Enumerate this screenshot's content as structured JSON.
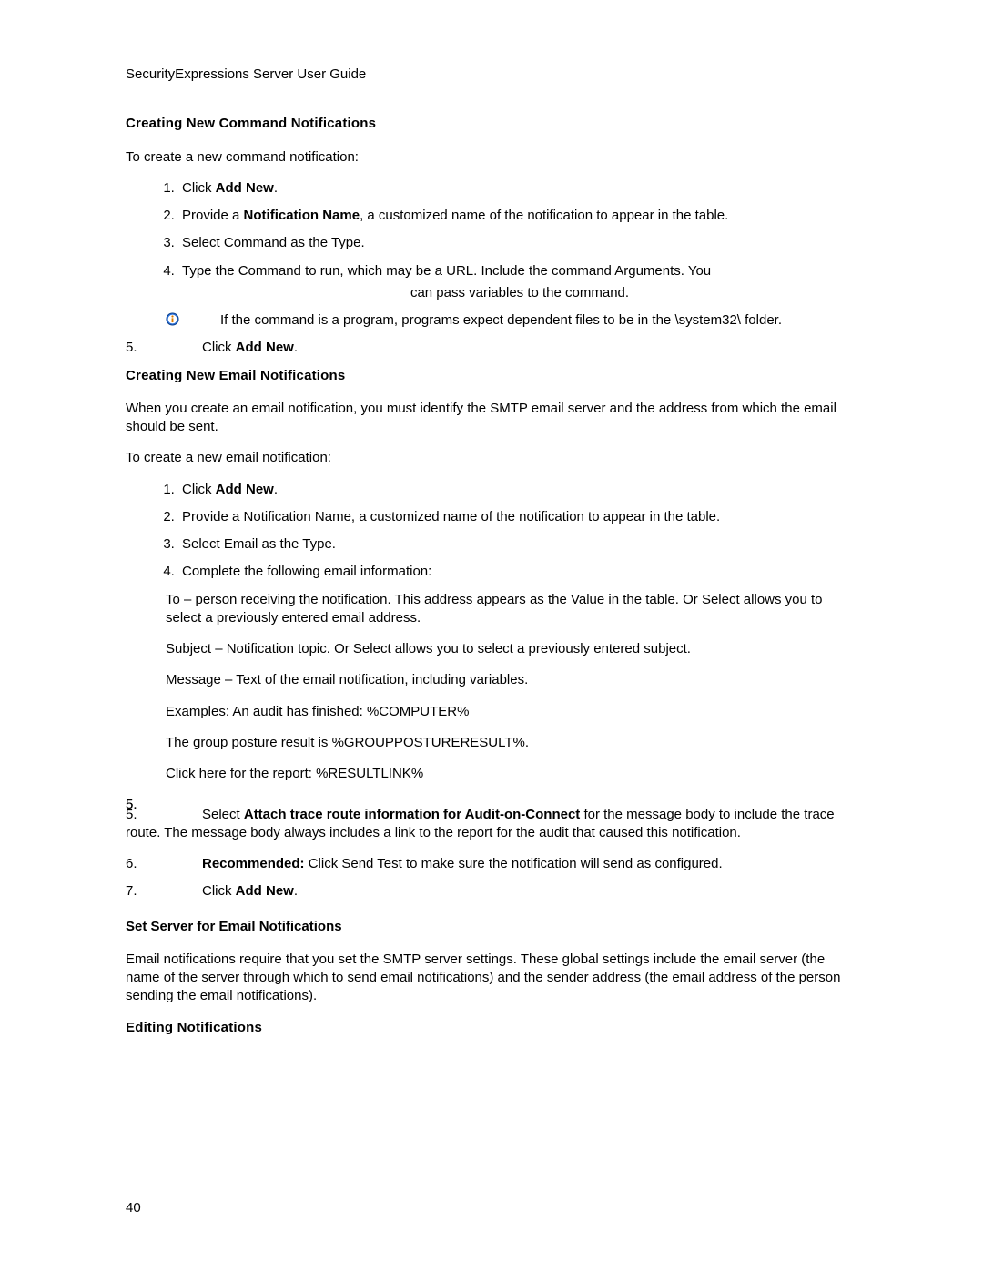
{
  "header": "SecurityExpressions Server User Guide",
  "h1": "Creating New Command Notifications",
  "p1": "To create a new command notification:",
  "list1": {
    "i1_pre": "Click ",
    "i1_bold": "Add New",
    "i1_post": ".",
    "i2_pre": "Provide a ",
    "i2_bold": "Notification Name",
    "i2_post": ", a customized name of the notification to appear in the table.",
    "i3": "Select Command as the Type.",
    "i4_line1": "Type the Command to run, which may be a URL. Include the command Arguments. You",
    "i4_line2": "can pass variables to the command."
  },
  "note1": "If the command is a program, programs expect dependent files to be in the \\system32\\ folder.",
  "item5": {
    "num": "5.",
    "pre": "Click ",
    "bold": "Add New",
    "post": "."
  },
  "h2": "Creating New Email Notifications",
  "p2": "When you create an email notification, you must identify the SMTP email server and the address from which the email should be sent.",
  "p3": "To create a new email notification:",
  "list2": {
    "i1_pre": "Click ",
    "i1_bold": "Add New",
    "i1_post": ".",
    "i2": "Provide a Notification Name, a customized name of the notification to appear in the table.",
    "i3": "Select Email as the Type.",
    "i4": "Complete the following email information:"
  },
  "sub": {
    "to": "To – person receiving the notification. This address appears as the Value in the table. Or Select allows you to select a previously entered email address.",
    "subject": "Subject – Notification topic. Or Select allows you to select a previously entered subject.",
    "message": "Message – Text of the email notification, including variables.",
    "examples": "Examples: An audit has finished: %COMPUTER%",
    "group": "The group posture result is %GROUPPOSTURERESULT%.",
    "link": "Click here for the report: %RESULTLINK%"
  },
  "item5b": {
    "num": "5.",
    "pre": "Select ",
    "bold": "Attach trace route information for Audit-on-Connect",
    "post": " for the message body to include the trace route. The message body always includes a link to the report for the audit that caused this notification."
  },
  "item6": {
    "num": "6.",
    "bold": "Recommended:",
    "post": " Click Send Test to make sure the notification will send as configured."
  },
  "item7": {
    "num": "7.",
    "pre": "Click ",
    "bold": "Add New",
    "post": "."
  },
  "h3": "Set Server for Email Notifications",
  "p4": "Email notifications require that you set the SMTP server settings. These global settings include the email server (the name of the server through which to send email notifications) and the sender address (the email address of the person sending the email notifications).",
  "h4": "Editing Notifications",
  "pageNumber": "40"
}
